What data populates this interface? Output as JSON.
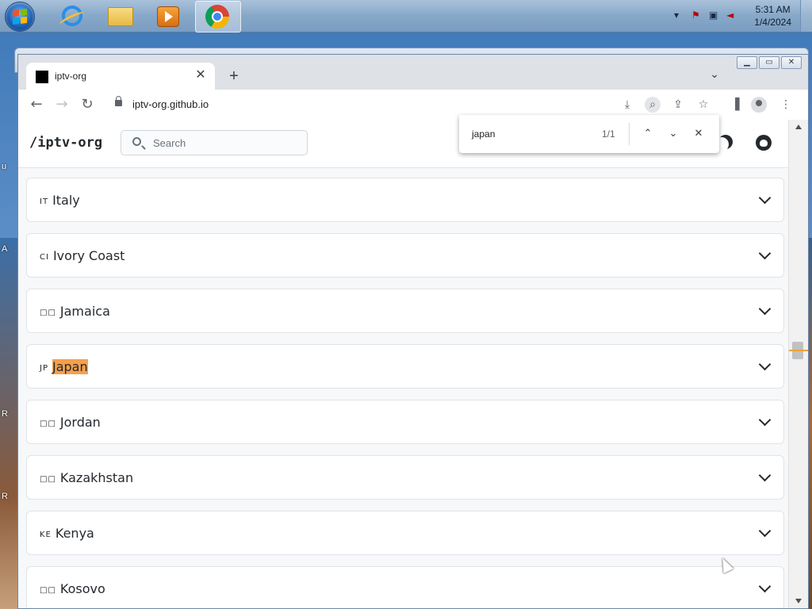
{
  "taskbar": {
    "clock_time": "5:31 AM",
    "clock_date": "1/4/2024",
    "apps": [
      "internet-explorer",
      "windows-explorer",
      "media-player",
      "google-chrome"
    ]
  },
  "desktop": {
    "edge_letters": [
      "u",
      "A",
      "R",
      "R"
    ]
  },
  "browser": {
    "tab_title": "iptv-org",
    "url": "iptv-org.github.io",
    "find": {
      "query": "japan",
      "count": "1/1"
    }
  },
  "site": {
    "logo": "/iptv-org",
    "search_placeholder": "Search"
  },
  "countries": [
    {
      "code": "IT",
      "name": "Italy",
      "highlight": false
    },
    {
      "code": "CI",
      "name": "Ivory Coast",
      "highlight": false
    },
    {
      "code": "□□",
      "name": "Jamaica",
      "highlight": false
    },
    {
      "code": "JP",
      "name": "Japan",
      "highlight": true
    },
    {
      "code": "□□",
      "name": "Jordan",
      "highlight": false
    },
    {
      "code": "□□",
      "name": "Kazakhstan",
      "highlight": false
    },
    {
      "code": "KE",
      "name": "Kenya",
      "highlight": false
    },
    {
      "code": "□□",
      "name": "Kosovo",
      "highlight": false
    }
  ],
  "colors": {
    "find_highlight": "#f5a04a",
    "accent_text": "#24292e"
  }
}
